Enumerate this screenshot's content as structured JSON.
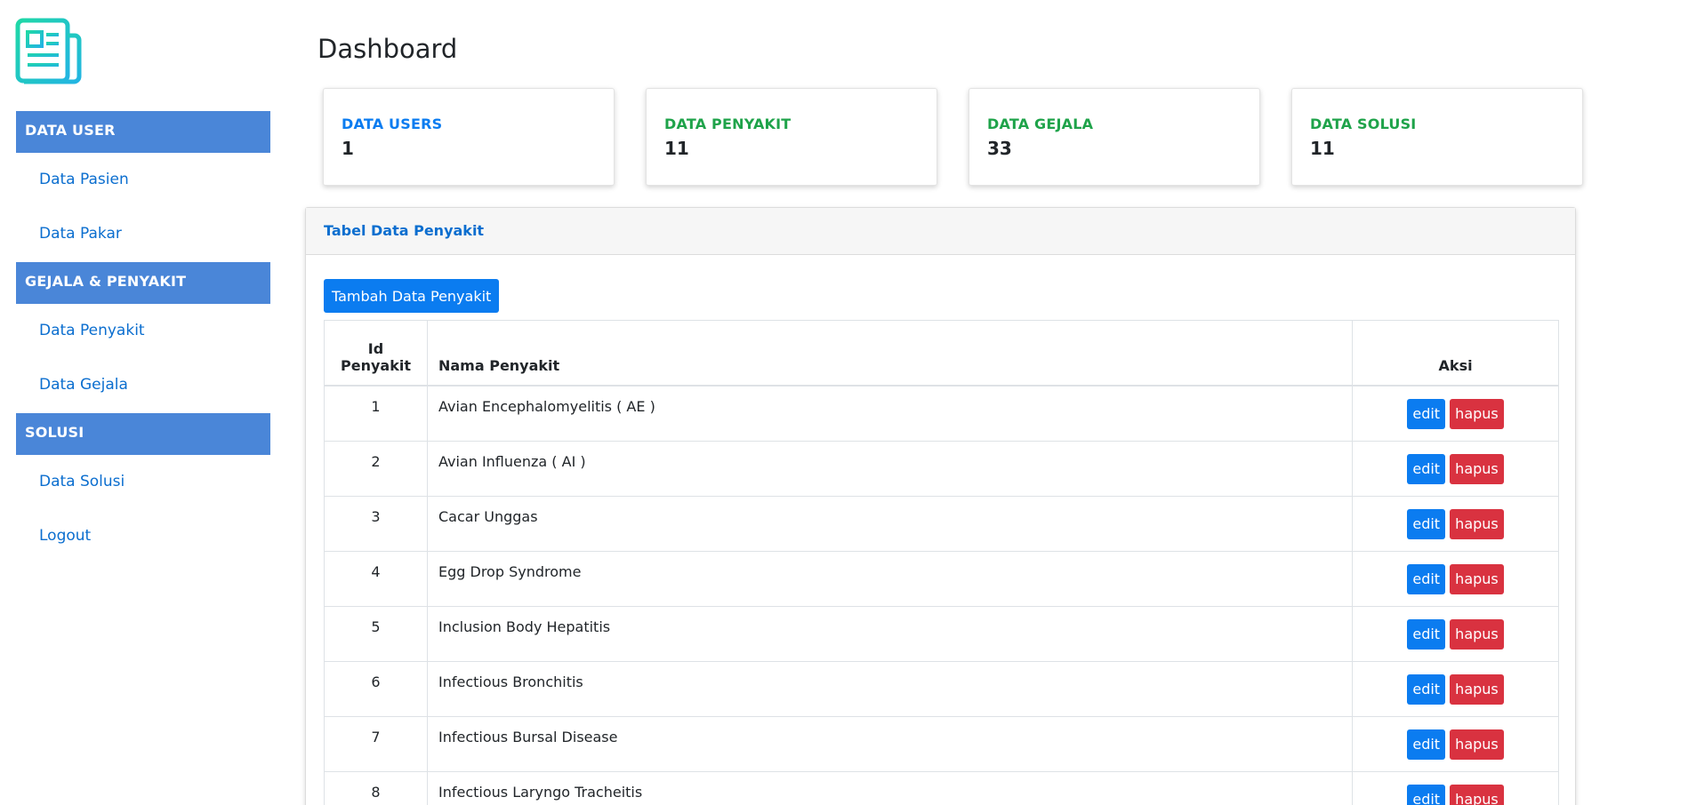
{
  "sidebar": {
    "logo_icon": "newspaper-icon",
    "sections": [
      {
        "header": "DATA USER",
        "links": [
          "Data Pasien",
          "Data Pakar"
        ]
      },
      {
        "header": "GEJALA & PENYAKIT",
        "links": [
          "Data Penyakit",
          "Data Gejala"
        ]
      },
      {
        "header": "SOLUSI",
        "links": [
          "Data Solusi",
          "Logout"
        ]
      }
    ]
  },
  "page": {
    "title": "Dashboard"
  },
  "stats": [
    {
      "label": "DATA USERS",
      "value": "1",
      "color": "#0b7cf0"
    },
    {
      "label": "DATA PENYAKIT",
      "value": "11",
      "color": "#1fa34a"
    },
    {
      "label": "DATA GEJALA",
      "value": "33",
      "color": "#1fa34a"
    },
    {
      "label": "DATA SOLUSI",
      "value": "11",
      "color": "#1fa34a"
    }
  ],
  "panel": {
    "title": "Tabel Data Penyakit",
    "add_button": "Tambah Data Penyakit",
    "columns": [
      "Id Penyakit",
      "Nama Penyakit",
      "Aksi"
    ],
    "edit_label": "edit",
    "delete_label": "hapus",
    "rows": [
      {
        "id": "1",
        "name": "Avian Encephalomyelitis ( AE )"
      },
      {
        "id": "2",
        "name": "Avian Influenza ( AI )"
      },
      {
        "id": "3",
        "name": "Cacar Unggas"
      },
      {
        "id": "4",
        "name": "Egg Drop Syndrome"
      },
      {
        "id": "5",
        "name": "Inclusion Body Hepatitis"
      },
      {
        "id": "6",
        "name": "Infectious Bronchitis"
      },
      {
        "id": "7",
        "name": "Infectious Bursal Disease"
      },
      {
        "id": "8",
        "name": "Infectious Laryngo Tracheitis"
      }
    ]
  },
  "colors": {
    "accent": "#0b7cf0",
    "sidebar_header": "#4a86d8",
    "danger": "#d93240",
    "logo": "#1fc9a8"
  }
}
